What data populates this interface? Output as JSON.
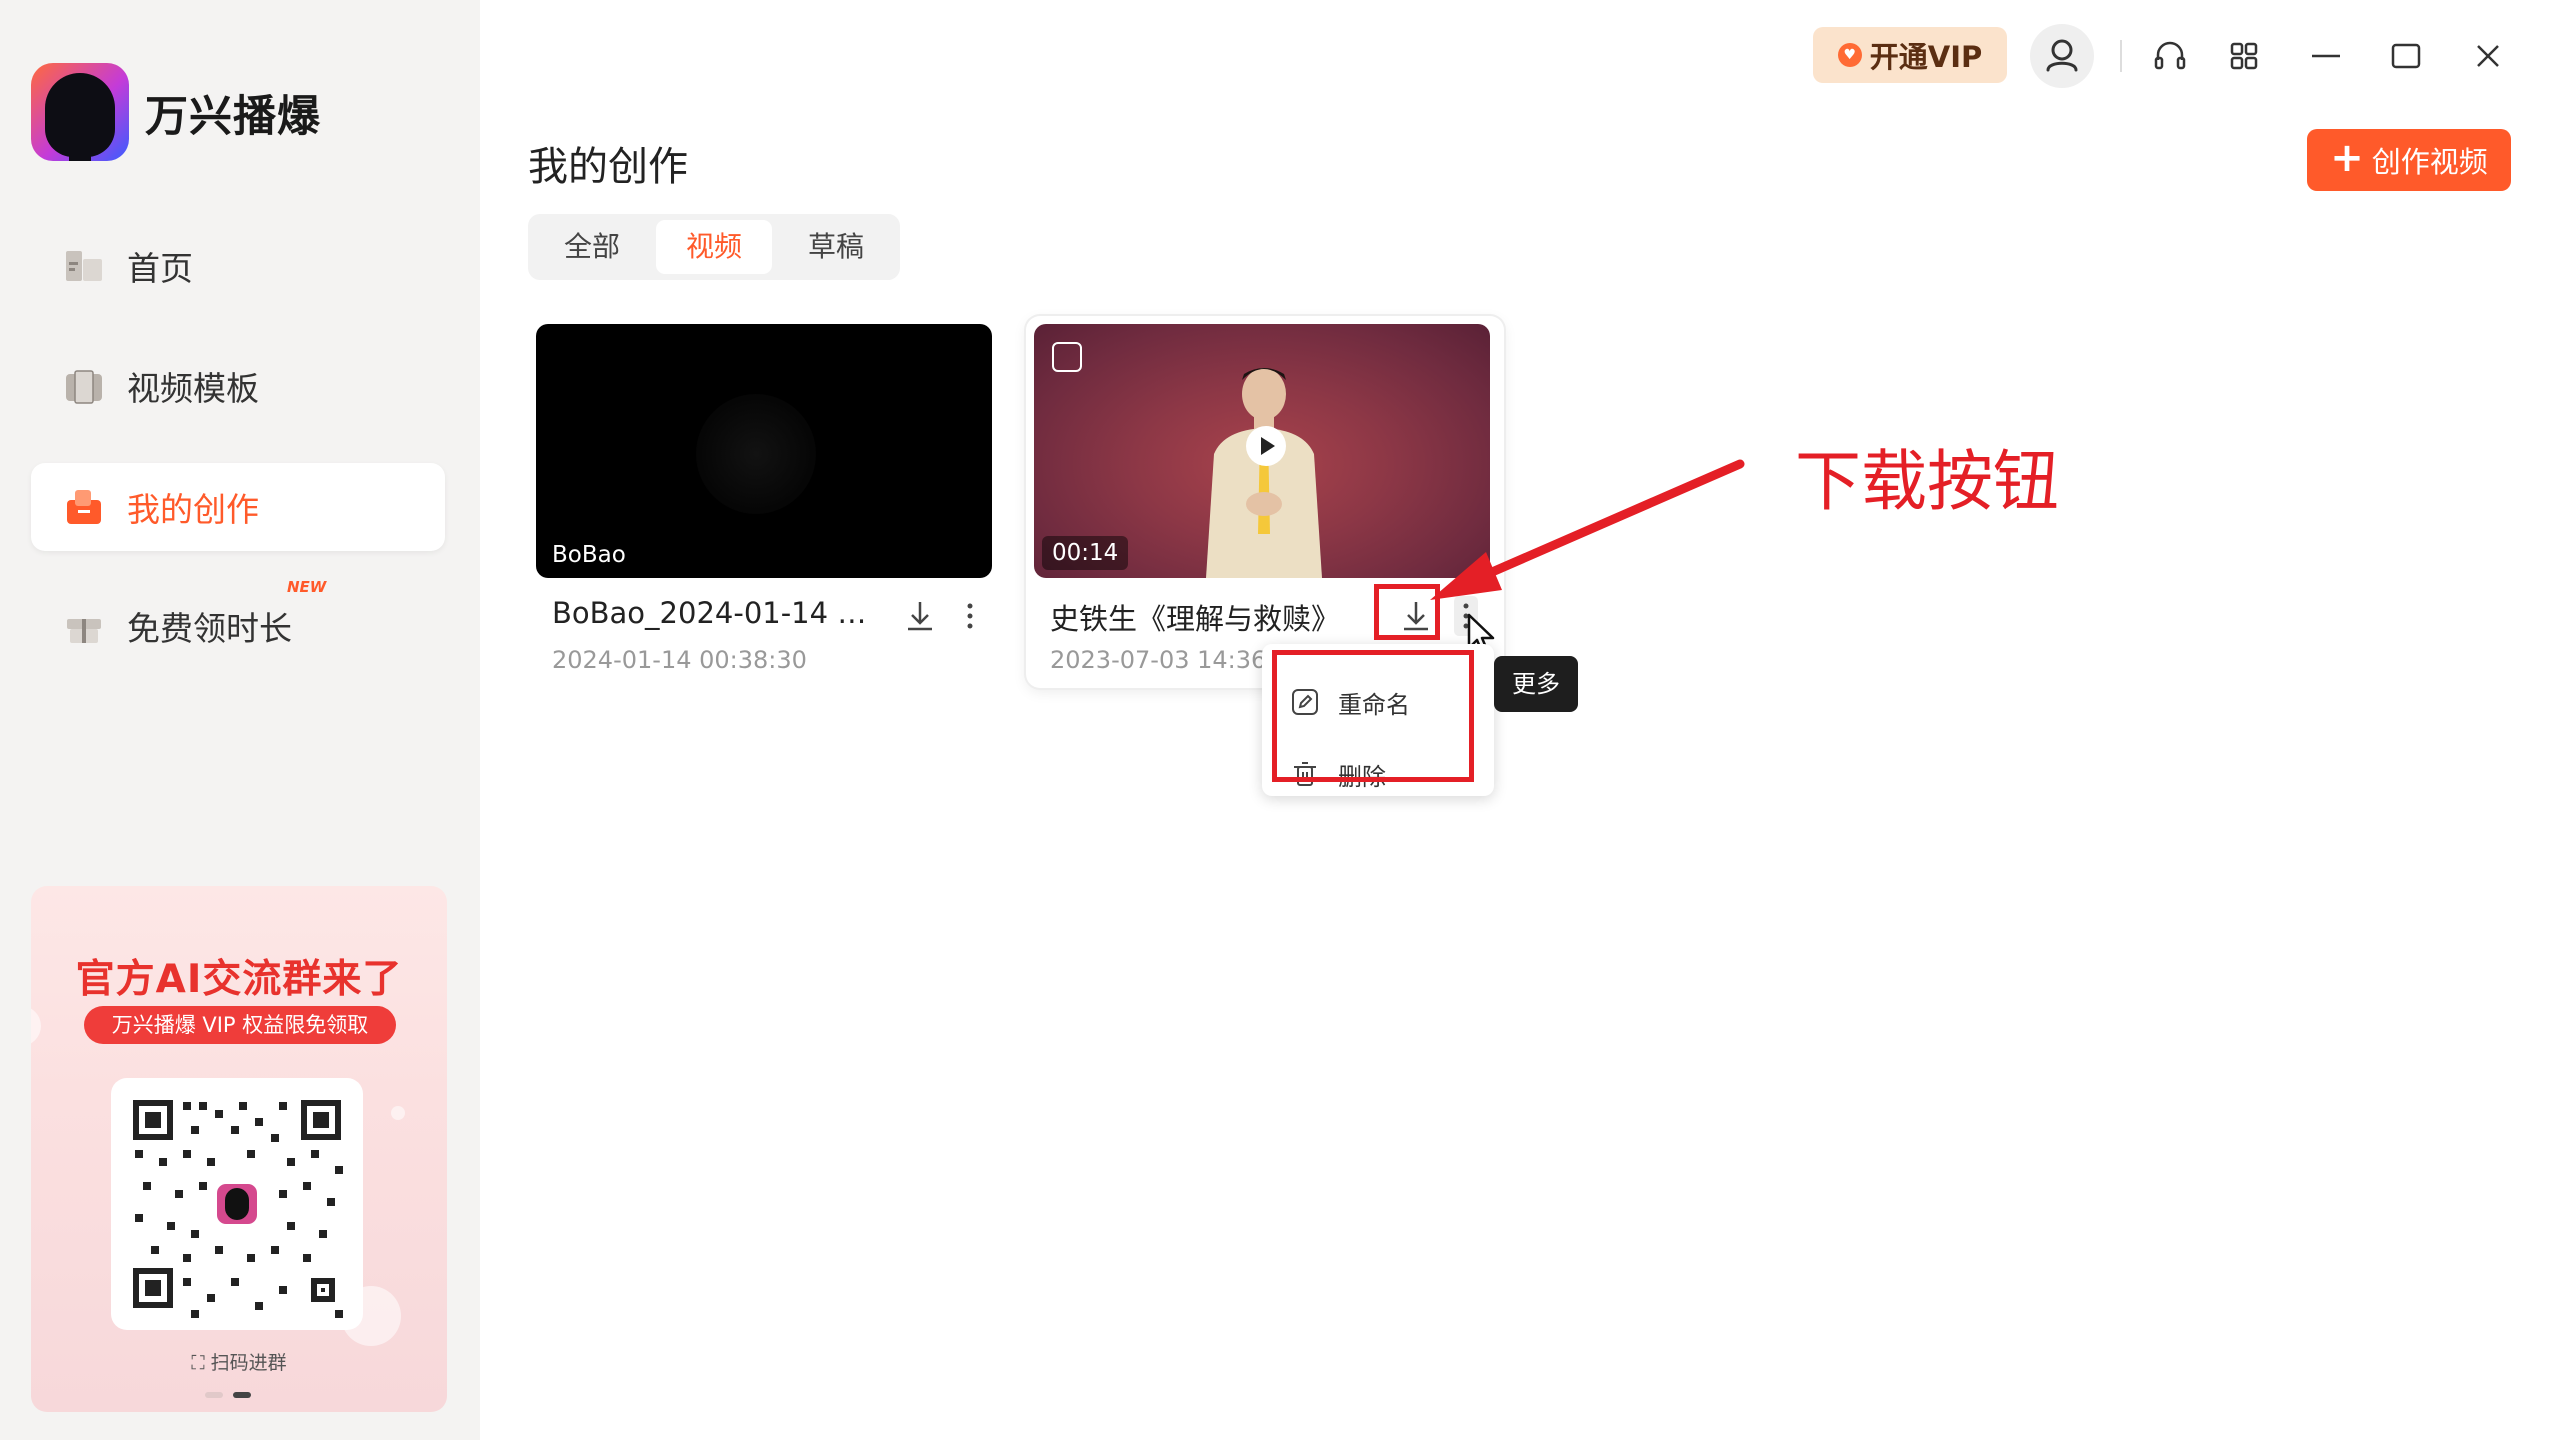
{
  "app": {
    "name": "万兴播爆"
  },
  "sidebar": {
    "items": [
      {
        "label": "首页",
        "icon": "home-icon",
        "active": false
      },
      {
        "label": "视频模板",
        "icon": "template-icon",
        "active": false
      },
      {
        "label": "我的创作",
        "icon": "creation-icon",
        "active": true
      },
      {
        "label": "免费领时长",
        "icon": "gift-icon",
        "active": false,
        "badge": "NEW"
      }
    ]
  },
  "promo": {
    "title": "官方AI交流群来了",
    "subtitle": "万兴播爆 VIP 权益限免领取",
    "scan_label": "扫码进群"
  },
  "header": {
    "vip_label": "开通VIP",
    "page_title": "我的创作",
    "create_label": "创作视频"
  },
  "tabs": [
    {
      "label": "全部",
      "active": false
    },
    {
      "label": "视频",
      "active": true
    },
    {
      "label": "草稿",
      "active": false
    }
  ],
  "videos": [
    {
      "thumb_label": "BoBao",
      "title": "BoBao_2024-01-14 00...",
      "date": "2024-01-14 00:38:30"
    },
    {
      "duration": "00:14",
      "title": "史铁生《理解与救赎》",
      "date": "2023-07-03 14:36:"
    }
  ],
  "menu": {
    "items": [
      {
        "label": "重命名",
        "icon": "rename-icon"
      },
      {
        "label": "删除",
        "icon": "trash-icon"
      }
    ],
    "tooltip": "更多"
  },
  "annotation": {
    "text": "下载按钮"
  },
  "colors": {
    "accent": "#ff5a2a",
    "highlight": "#e41f26",
    "sidebar_bg": "#f4f3f2"
  }
}
